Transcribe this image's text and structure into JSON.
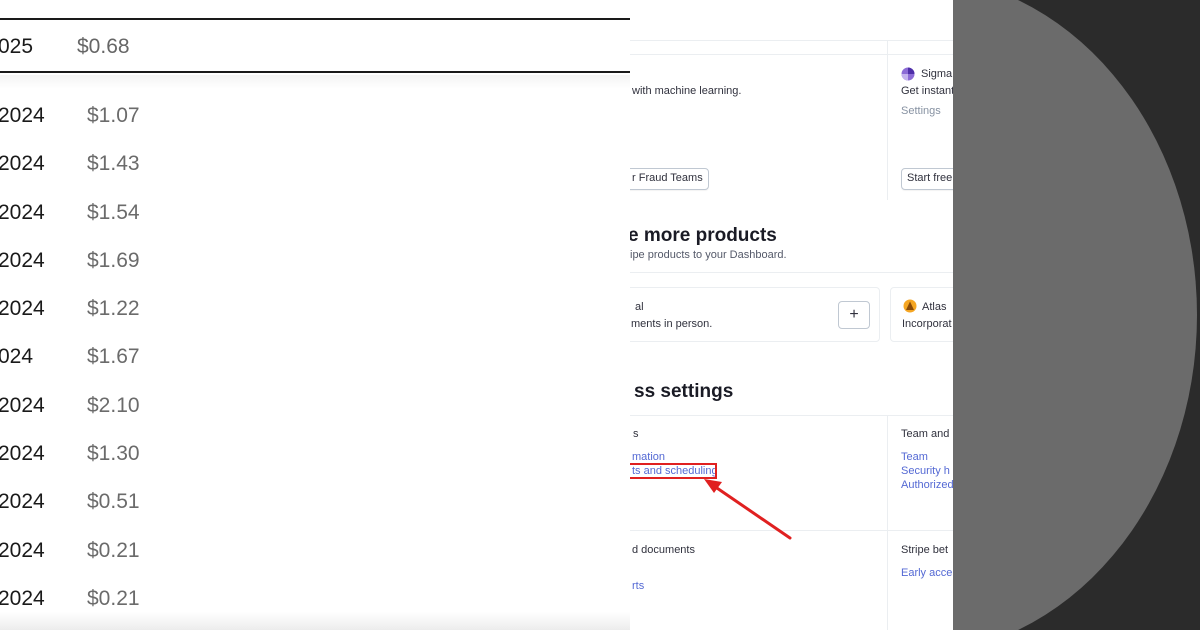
{
  "price_list": {
    "header": {
      "date": "025",
      "price": "$0.68"
    },
    "rows": [
      {
        "date": "2024",
        "price": "$1.07"
      },
      {
        "date": "2024",
        "price": "$1.43"
      },
      {
        "date": "2024",
        "price": "$1.54"
      },
      {
        "date": "2024",
        "price": "$1.69"
      },
      {
        "date": "2024",
        "price": "$1.22"
      },
      {
        "date": "024",
        "price": "$1.67"
      },
      {
        "date": "2024",
        "price": "$2.10"
      },
      {
        "date": "2024",
        "price": "$1.30"
      },
      {
        "date": "2024",
        "price": "$0.51"
      },
      {
        "date": "2024",
        "price": "$0.21"
      },
      {
        "date": "2024",
        "price": "$0.21"
      }
    ]
  },
  "dashboard": {
    "top_card": {
      "description": "with machine learning.",
      "button_label": "r Fraud Teams"
    },
    "sigma_card": {
      "title": "Sigma",
      "description": "Get instant",
      "settings_label": "Settings",
      "button_label": "Start free"
    },
    "more_products": {
      "title": "e more products",
      "subtitle": "ipe products to your Dashboard.",
      "terminal": {
        "title": "al",
        "description": "ments in person.",
        "add_label": "+"
      },
      "atlas": {
        "title": "Atlas",
        "description": "Incorporat"
      }
    },
    "business_settings": {
      "title": "ss settings",
      "col1_header": "s",
      "col1_links": [
        "mation",
        "ts and scheduling"
      ],
      "col2_header": "Team and",
      "col2_links": [
        "Team",
        "Security h",
        "Authorized"
      ],
      "row2_col1_header": "d documents",
      "row2_col1_link": "rts",
      "row2_col2_header": "Stripe bet",
      "row2_col2_link": "Early acce"
    },
    "accent_color": "#5469d4",
    "annotation_color": "#e02020"
  }
}
